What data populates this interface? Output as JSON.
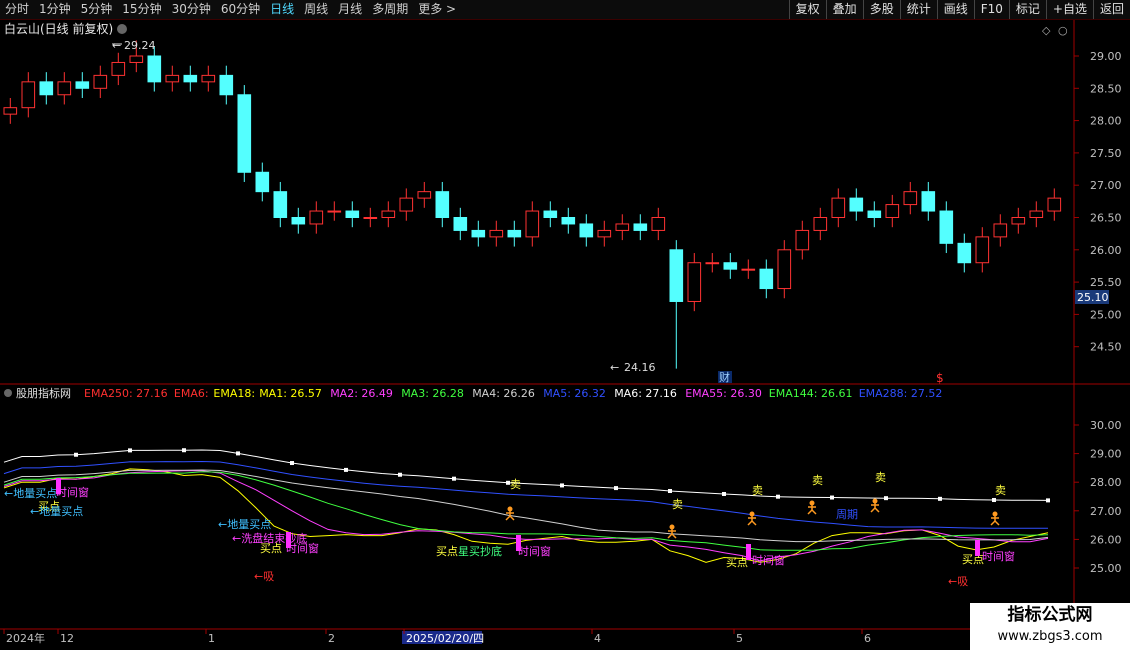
{
  "toolbar": {
    "periods": [
      "分时",
      "1分钟",
      "5分钟",
      "15分钟",
      "30分钟",
      "60分钟",
      "日线",
      "周线",
      "月线",
      "多周期",
      "更多 >"
    ],
    "selected_period": "日线",
    "tools": [
      "复权",
      "叠加",
      "多股",
      "统计",
      "画线",
      "F10",
      "标记",
      "+自选",
      "返回"
    ]
  },
  "main_chart": {
    "title": "白云山(日线 前复权)",
    "high_marker": "29.24",
    "low_marker": "24.16",
    "price_ticks": [
      "29.00",
      "28.50",
      "28.00",
      "27.50",
      "27.00",
      "26.50",
      "26.00",
      "25.50",
      "25.00",
      "24.50"
    ],
    "current_price": "25.10",
    "event_marks": [
      "财",
      "$"
    ]
  },
  "indicator": {
    "name": "股朋指标网",
    "legend": [
      {
        "label": "EMA250: 27.16",
        "color": "#ff3030"
      },
      {
        "label": "EMA6:",
        "color": "#ff3030"
      },
      {
        "label": "EMA18:",
        "color": "#ffff00"
      },
      {
        "label": "MA1: 26.57",
        "color": "#ffff00"
      },
      {
        "label": "MA2: 26.49",
        "color": "#ff40ff"
      },
      {
        "label": "MA3: 26.28",
        "color": "#40ff40"
      },
      {
        "label": "MA4: 26.26",
        "color": "#d0d0d0"
      },
      {
        "label": "MA5: 26.32",
        "color": "#3050ff"
      },
      {
        "label": "MA6: 27.16",
        "color": "#ffffff"
      },
      {
        "label": "EMA55: 26.30",
        "color": "#ff40ff"
      },
      {
        "label": "EMA144: 26.61",
        "color": "#40ff40"
      },
      {
        "label": "EMA288: 27.52",
        "color": "#3050ff"
      }
    ],
    "ticks": [
      "30.00",
      "29.00",
      "28.00",
      "27.00",
      "26.00",
      "25.00"
    ],
    "labels": {
      "sell": "卖",
      "buy": "买点",
      "ground_buy": "←地量买点",
      "time_window": "时间窗",
      "wash_end": "←洗盘结束抄底",
      "xi": "←吸",
      "star_buy": "星买抄底",
      "cycle": "周期"
    }
  },
  "time_axis": {
    "labels": [
      "2024年",
      "12",
      "1",
      "2",
      "2025/02/20/四",
      "4",
      "5",
      "6"
    ]
  },
  "watermark": {
    "line1": "指标公式网",
    "line2": "www.zbgs3.com"
  },
  "chart_data": {
    "type": "candlestick",
    "title": "白云山(日线 前复权)",
    "y_range": [
      24.2,
      29.6
    ],
    "x_labels": [
      "2024年",
      "12",
      "1",
      "2",
      "2025/02/20/四",
      "4",
      "5",
      "6"
    ],
    "closes_approx": [
      28.2,
      28.6,
      28.4,
      28.6,
      28.5,
      28.7,
      28.9,
      29.0,
      28.6,
      28.7,
      28.6,
      28.7,
      28.4,
      27.2,
      26.9,
      26.5,
      26.4,
      26.6,
      26.6,
      26.5,
      26.5,
      26.6,
      26.8,
      26.9,
      26.5,
      26.3,
      26.2,
      26.3,
      26.2,
      26.6,
      26.5,
      26.4,
      26.2,
      26.3,
      26.4,
      26.3,
      26.5,
      25.2,
      25.8,
      25.8,
      25.7,
      25.7,
      25.4,
      26.0,
      26.3,
      26.5,
      26.8,
      26.6,
      26.5,
      26.7,
      26.9,
      26.6,
      26.1,
      25.8,
      26.2,
      26.4,
      26.5,
      26.6,
      26.8
    ],
    "high": 29.24,
    "low": 24.16,
    "last": 25.1
  }
}
